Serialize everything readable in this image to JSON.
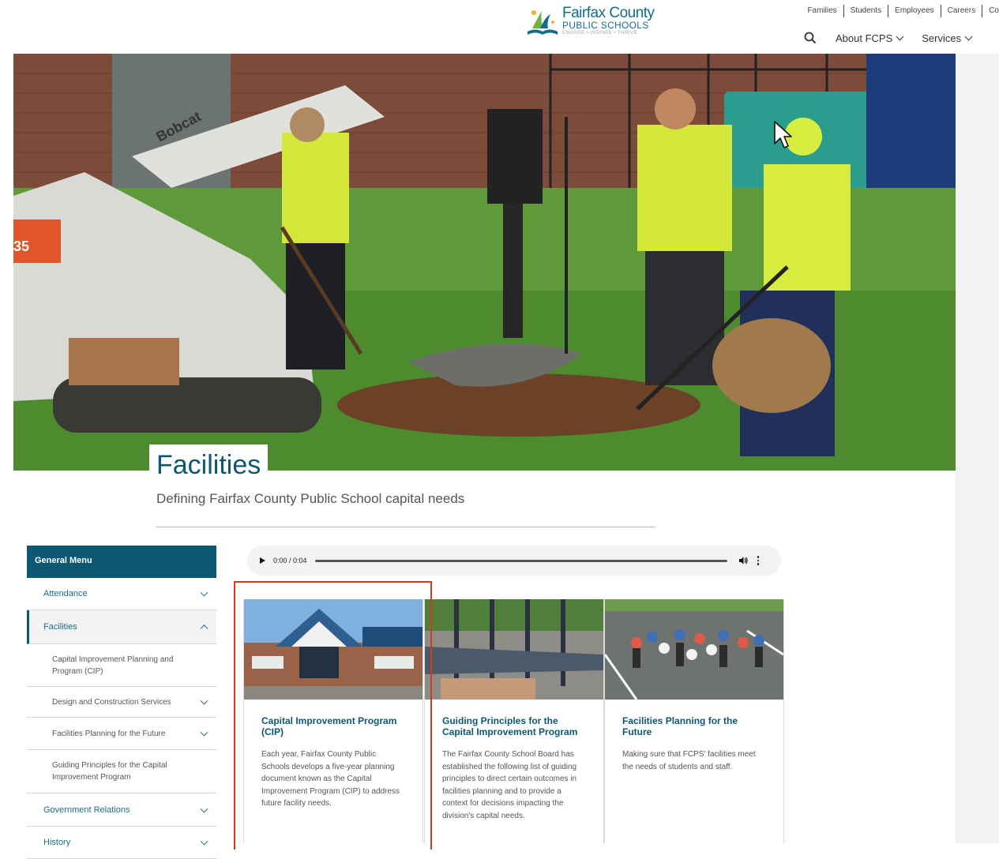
{
  "header": {
    "logo": {
      "name": "Fairfax County",
      "sub": "PUBLIC SCHOOLS",
      "tagline": "ENGAGE • INSPIRE • THRIVE"
    },
    "utility_links": [
      "Families",
      "Students",
      "Employees",
      "Careers",
      "Co"
    ],
    "nav": {
      "search_icon": "search-icon",
      "items": [
        {
          "label": "About FCPS"
        },
        {
          "label": "Services"
        }
      ]
    }
  },
  "hero": {
    "machine_label": "Bobcat",
    "machine_number": "35"
  },
  "page": {
    "title": "Facilities",
    "subtitle": "Defining Fairfax County Public School capital needs"
  },
  "sidebar": {
    "heading": "General Menu",
    "items": [
      {
        "label": "Attendance"
      },
      {
        "label": "Facilities"
      },
      {
        "label": "Capital Improvement Planning and Program (CIP)"
      },
      {
        "label": "Design and Construction Services"
      },
      {
        "label": "Facilities Planning for the Future"
      },
      {
        "label": "Guiding Principles for the Capital Improvement Program"
      },
      {
        "label": "Government Relations"
      },
      {
        "label": "History"
      }
    ]
  },
  "audio": {
    "time": "0:00 / 0:04",
    "progress": 0
  },
  "cards": [
    {
      "title": "Capital Improvement Program (CIP)",
      "description": "Each year, Fairfax County Public Schools develops a five-year planning document known as the Capital Improvement Program (CIP) to address future facility needs."
    },
    {
      "title": "Guiding Principles for the Capital Improvement Program",
      "description": "The Fairfax County School Board has established the following list of guiding principles to direct certain outcomes in facilities planning and to provide a context for decisions impacting the division's capital needs."
    },
    {
      "title": "Facilities Planning for the Future",
      "description": "Making sure that FCPS' facilities meet the needs of students and staff."
    }
  ],
  "colors": {
    "brand": "#0c5872",
    "link": "#1b6d88",
    "focus_outline": "#d33a1e"
  }
}
